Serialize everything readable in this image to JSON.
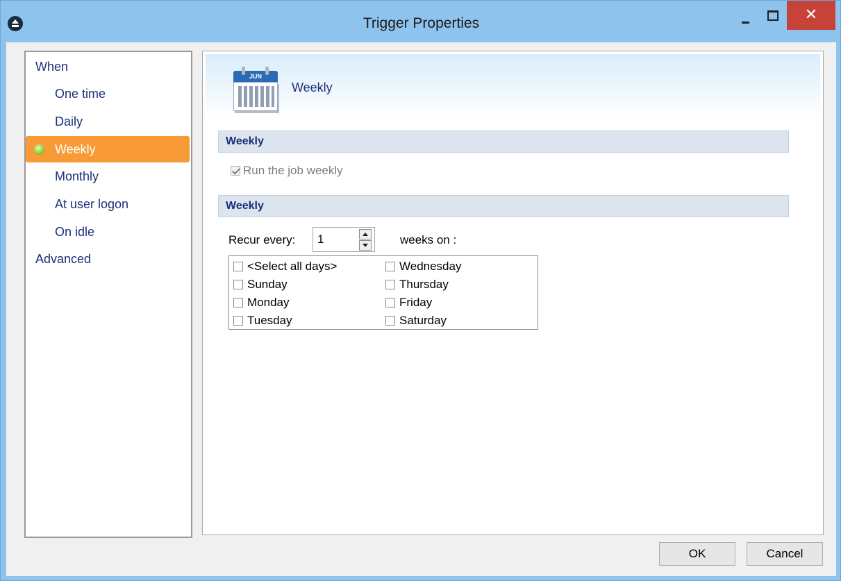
{
  "window": {
    "title": "Trigger Properties",
    "close_glyph": "✕"
  },
  "nav": {
    "items": [
      {
        "label": "When",
        "level": 0
      },
      {
        "label": "One time",
        "level": 1
      },
      {
        "label": "Daily",
        "level": 1
      },
      {
        "label": "Weekly",
        "level": 1,
        "selected": true
      },
      {
        "label": "Monthly",
        "level": 1
      },
      {
        "label": "At user logon",
        "level": 1
      },
      {
        "label": "On idle",
        "level": 1
      },
      {
        "label": "Advanced",
        "level": 0
      }
    ]
  },
  "header": {
    "icon": "calendar-icon",
    "icon_text": "JUN",
    "title": "Weekly"
  },
  "sections": {
    "first_title": "Weekly",
    "second_title": "Weekly"
  },
  "run_weekly": {
    "label": "Run the job weekly",
    "checked": true,
    "disabled": true
  },
  "recur": {
    "label": "Recur every:",
    "value": "1",
    "suffix": "weeks on :"
  },
  "days": {
    "select_all": "<Select all days>",
    "sunday": "Sunday",
    "monday": "Monday",
    "tuesday": "Tuesday",
    "wednesday": "Wednesday",
    "thursday": "Thursday",
    "friday": "Friday",
    "saturday": "Saturday"
  },
  "buttons": {
    "ok": "OK",
    "cancel": "Cancel"
  },
  "colors": {
    "selection": "#f89a36",
    "nav_text": "#1b2f7a",
    "frame": "#8ec3ee",
    "close": "#c7433a"
  }
}
